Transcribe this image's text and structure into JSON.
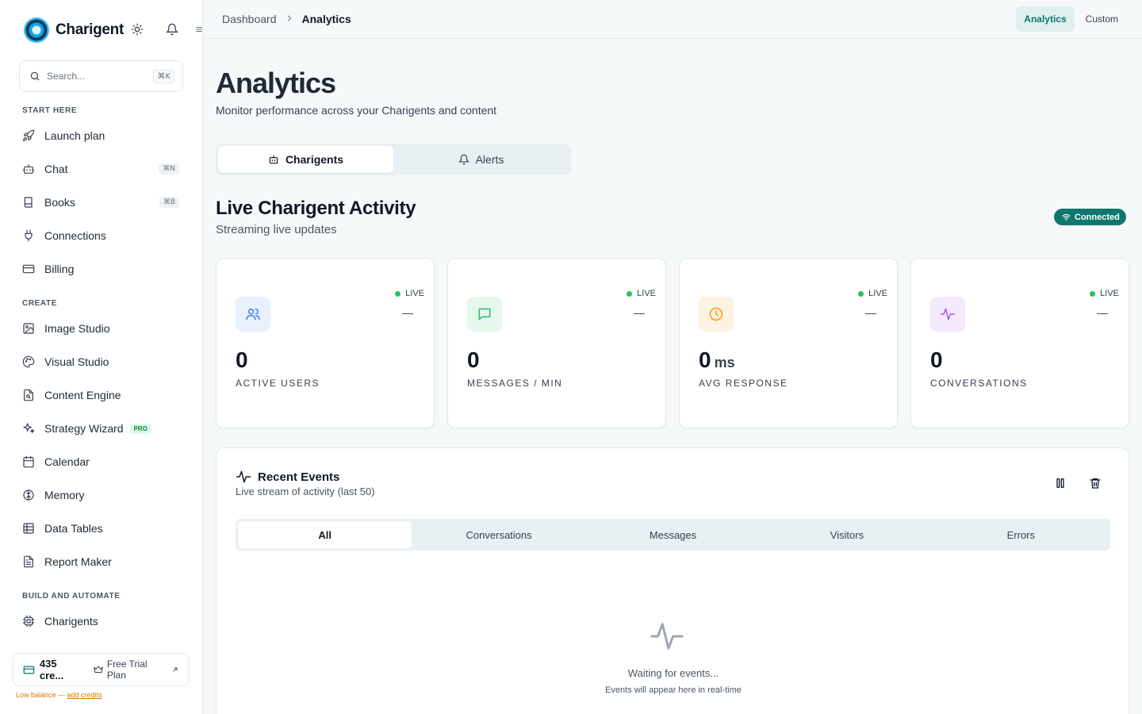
{
  "app": {
    "name": "Charigent"
  },
  "search": {
    "placeholder": "Search...",
    "shortcut": "⌘K"
  },
  "sidebar": {
    "sections": [
      {
        "label": "START HERE"
      },
      {
        "label": "CREATE"
      },
      {
        "label": "BUILD AND AUTOMATE"
      }
    ],
    "items": [
      {
        "label": "Launch plan",
        "icon": "rocket-icon"
      },
      {
        "label": "Chat",
        "icon": "bot-icon",
        "shortcut": "⌘N"
      },
      {
        "label": "Books",
        "icon": "book-icon",
        "shortcut": "⌘B"
      },
      {
        "label": "Connections",
        "icon": "plug-icon"
      },
      {
        "label": "Billing",
        "icon": "credit-card-icon"
      },
      {
        "label": "Image Studio",
        "icon": "image-icon"
      },
      {
        "label": "Visual Studio",
        "icon": "palette-icon"
      },
      {
        "label": "Content Engine",
        "icon": "file-search-icon"
      },
      {
        "label": "Strategy Wizard",
        "icon": "sparkles-icon",
        "badge": "PRO"
      },
      {
        "label": "Calendar",
        "icon": "calendar-icon"
      },
      {
        "label": "Memory",
        "icon": "brain-icon"
      },
      {
        "label": "Data Tables",
        "icon": "table-icon"
      },
      {
        "label": "Report Maker",
        "icon": "report-icon"
      },
      {
        "label": "Charigents",
        "icon": "cpu-icon"
      }
    ]
  },
  "credits": {
    "value": "435 cre...",
    "plan": "Free Trial Plan",
    "low_text": "Low balance — ",
    "add_link": "add credits"
  },
  "header": {
    "breadcrumb": [
      "Dashboard",
      "Analytics"
    ],
    "tabs": [
      {
        "label": "Analytics",
        "active": true
      },
      {
        "label": "Custom",
        "active": false
      }
    ]
  },
  "page": {
    "title": "Analytics",
    "subtitle": "Monitor performance across your Charigents and content",
    "tabs": [
      {
        "label": "Charigents",
        "icon": "bot-icon",
        "active": true
      },
      {
        "label": "Alerts",
        "icon": "bell-icon",
        "active": false
      }
    ]
  },
  "live": {
    "title": "Live Charigent Activity",
    "subtitle": "Streaming live updates",
    "status": "Connected",
    "status_color": "#0f766e"
  },
  "stats": [
    {
      "value": "0",
      "unit": "",
      "label": "ACTIVE USERS",
      "live": "LIVE",
      "trend": "—",
      "icon": "users-icon",
      "color": "#3b82f6",
      "bg": "#e8f1fd"
    },
    {
      "value": "0",
      "unit": "",
      "label": "MESSAGES / MIN",
      "live": "LIVE",
      "trend": "—",
      "icon": "message-icon",
      "color": "#22c55e",
      "bg": "#e6f7ec"
    },
    {
      "value": "0",
      "unit": "ms",
      "label": "AVG RESPONSE",
      "live": "LIVE",
      "trend": "—",
      "icon": "clock-icon",
      "color": "#f59e0b",
      "bg": "#fdf1e1"
    },
    {
      "value": "0",
      "unit": "",
      "label": "CONVERSATIONS",
      "live": "LIVE",
      "trend": "—",
      "icon": "activity-icon",
      "color": "#a855f7",
      "bg": "#f4e9fd"
    }
  ],
  "events": {
    "title": "Recent Events",
    "subtitle": "Live stream of activity (last 50)",
    "tabs": [
      "All",
      "Conversations",
      "Messages",
      "Visitors",
      "Errors"
    ],
    "empty_title": "Waiting for events...",
    "empty_subtitle": "Events will appear here in real-time"
  }
}
